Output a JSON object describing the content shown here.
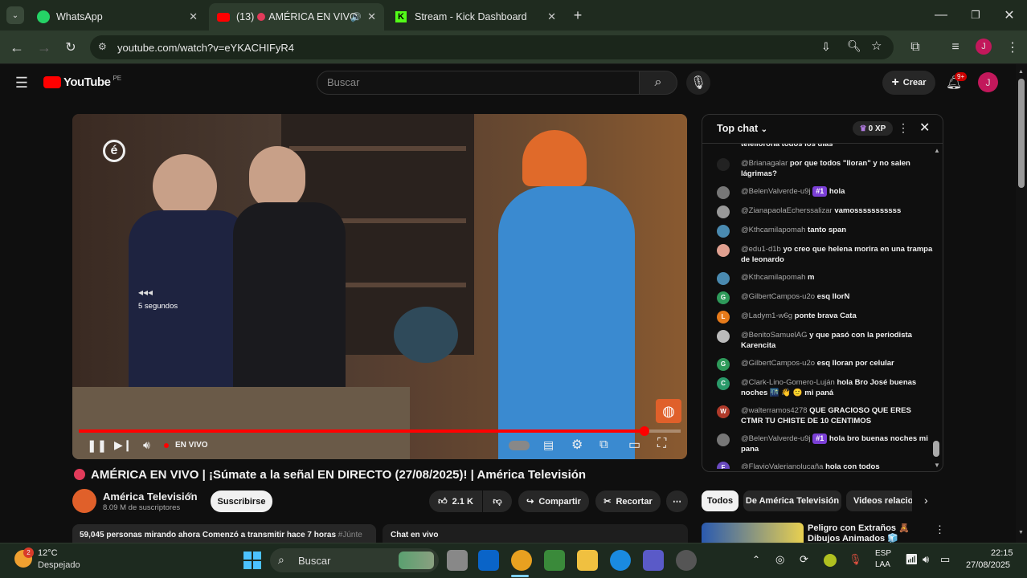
{
  "browser": {
    "tabs": [
      {
        "label": "WhatsApp"
      },
      {
        "label": "(13) ",
        "title": "AMÉRICA EN VIVO"
      },
      {
        "label": "Stream - Kick Dashboard"
      }
    ],
    "url": "youtube.com/watch?v=eYKACHIFyR4",
    "profile_initial": "J"
  },
  "youtube": {
    "logo_text": "YouTube",
    "region": "PE",
    "search_placeholder": "Buscar",
    "create_label": "Crear",
    "notif_count": "9+",
    "avatar": "J"
  },
  "player": {
    "skip_text": "5 segundos",
    "live_label": "EN VIVO",
    "progress": 0.94
  },
  "video_info": {
    "title": "AMÉRICA EN VIVO | ¡Súmate a la señal EN DIRECTO (27/08/2025)! | América Televisión",
    "channel": "América Televisión",
    "subscribers": "8.09 M de suscriptores",
    "subscribe_label": "Suscribirse",
    "likes": "2.1 K",
    "share_label": "Compartir",
    "clip_label": "Recortar",
    "desc_line": "59,045 personas mirando ahora  Comenzó a transmitir hace 7 horas",
    "hashtag": "#Júnte",
    "chat_replay": "Chat en vivo"
  },
  "chat": {
    "header": "Top chat",
    "xp": "0 XP",
    "messages": [
      {
        "user": "",
        "text": "telellorona todos los dias",
        "color": "#666"
      },
      {
        "user": "@Brianagalar",
        "text": "por que todos \"lloran\" y no salen lágrimas?",
        "color": "#222"
      },
      {
        "user": "@BelenValverde-u9j",
        "badge": "#1",
        "text": "hola",
        "color": "#777"
      },
      {
        "user": "@ZianapaolaEcherssalizar",
        "text": "vamosssssssssss",
        "color": "#999"
      },
      {
        "user": "@Kthcamilapomah",
        "text": "tanto span",
        "color": "#4a8ab0"
      },
      {
        "user": "@edu1-d1b",
        "text": "yo creo que helena morira en una trampa de leonardo",
        "color": "#e0a090"
      },
      {
        "user": "@Kthcamilapomah",
        "text": "m",
        "color": "#4a8ab0"
      },
      {
        "user": "@GilbertCampos-u2o",
        "text": "esq llorN",
        "color": "#2e9a5a",
        "initial": "G"
      },
      {
        "user": "@Ladym1-w6g",
        "text": "ponte brava Cata",
        "color": "#e67a1a",
        "initial": "L"
      },
      {
        "user": "@BenitoSamuelAG",
        "text": "y que pasó con la periodista Karencita",
        "color": "#bbb"
      },
      {
        "user": "@GilbertCampos-u2o",
        "text": "esq lloran por celular",
        "color": "#2e9a5a",
        "initial": "G"
      },
      {
        "user": "@Clark-Lino-Gomero-Luján",
        "text": "hola Bro José buenas noches 🌃 👋 🙂 mi paná",
        "color": "#2a9a6a",
        "initial": "C"
      },
      {
        "user": "@walterramos4278",
        "text": "QUE GRACIOSO QUE ERES CTMR TU CHISTE DE 10 CENTIMOS",
        "color": "#b03a2a",
        "initial": "W"
      },
      {
        "user": "@BelenValverde-u9j",
        "badge": "#1",
        "text": "hola bro buenas noches mi pana",
        "color": "#777"
      },
      {
        "user": "@FlavioValerianolucaña",
        "text": "hola con todos",
        "color": "#6a4ac0",
        "initial": "F"
      }
    ]
  },
  "chips": [
    "Todos",
    "De América Televisión",
    "Videos relacion"
  ],
  "rec": {
    "title": "Peligro con Extraños 🧸 Dibujos Animados 🧊 Sheriff"
  },
  "taskbar": {
    "temp": "12°C",
    "weather": "Despejado",
    "weather_badge": "2",
    "search": "Buscar",
    "lang1": "ESP",
    "lang2": "LAA",
    "time": "22:15",
    "date": "27/08/2025"
  }
}
